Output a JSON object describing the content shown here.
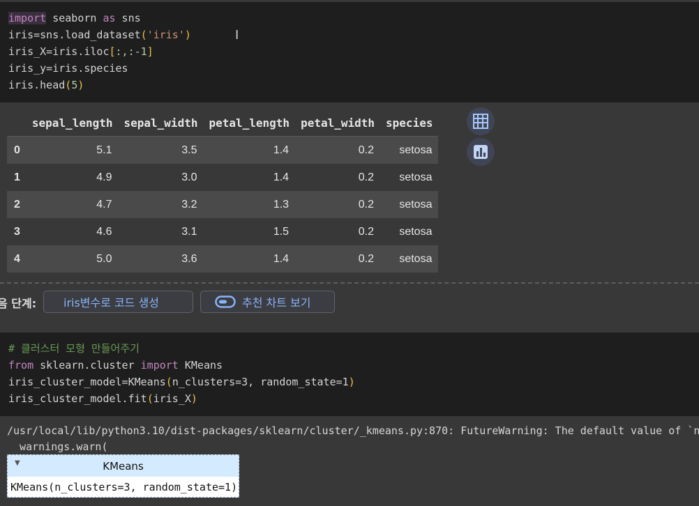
{
  "cell1": {
    "lines": [
      [
        "import",
        " seaborn ",
        "as",
        " sns"
      ],
      [
        "iris=sns.load_dataset",
        "(",
        "'iris'",
        ")"
      ],
      [
        "iris_X=iris.iloc",
        "[",
        ":,:-1",
        "]"
      ],
      [
        "iris_y=iris.species"
      ],
      [
        "iris.head",
        "(",
        "5",
        ")"
      ]
    ]
  },
  "dataframe": {
    "columns": [
      "sepal_length",
      "sepal_width",
      "petal_length",
      "petal_width",
      "species"
    ],
    "rows": [
      {
        "index": "0",
        "cells": [
          "5.1",
          "3.5",
          "1.4",
          "0.2",
          "setosa"
        ]
      },
      {
        "index": "1",
        "cells": [
          "4.9",
          "3.0",
          "1.4",
          "0.2",
          "setosa"
        ]
      },
      {
        "index": "2",
        "cells": [
          "4.7",
          "3.2",
          "1.3",
          "0.2",
          "setosa"
        ]
      },
      {
        "index": "3",
        "cells": [
          "4.6",
          "3.1",
          "1.5",
          "0.2",
          "setosa"
        ]
      },
      {
        "index": "4",
        "cells": [
          "5.0",
          "3.6",
          "1.4",
          "0.2",
          "setosa"
        ]
      }
    ],
    "side_buttons": [
      "table-icon",
      "chart-icon"
    ]
  },
  "next_steps": {
    "label": "음 단계:",
    "generate_code_label": "iris변수로 코드 생성",
    "recommended_charts_label": "추천 차트 보기"
  },
  "cell2": {
    "comment": "# 클러스터 모형 만들어주기",
    "line2": [
      "from",
      " sklearn.cluster ",
      "import",
      " KMeans"
    ],
    "line3": [
      "iris_cluster_model=KMeans",
      "(",
      "n_clusters=3, random_state=1",
      ")"
    ],
    "line4": [
      "iris_cluster_model.fit",
      "(",
      "iris_X",
      ")"
    ]
  },
  "output2": {
    "warning_line1": "/usr/local/lib/python3.10/dist-packages/sklearn/cluster/_kmeans.py:870: FutureWarning: The default value of `n_",
    "warning_line2": "  warnings.warn(",
    "estimator_name": "KMeans",
    "estimator_repr": "KMeans(n_clusters=3, random_state=1)"
  },
  "colors": {
    "cell_bg": "#1e1e1e",
    "output_bg": "#383838",
    "keyword": "#c586c0",
    "string": "#ce9178",
    "comment": "#6a9955",
    "bracket": "#e8c34a",
    "chip_text": "#8ab4f8",
    "estimator_header": "#d4ebff"
  }
}
